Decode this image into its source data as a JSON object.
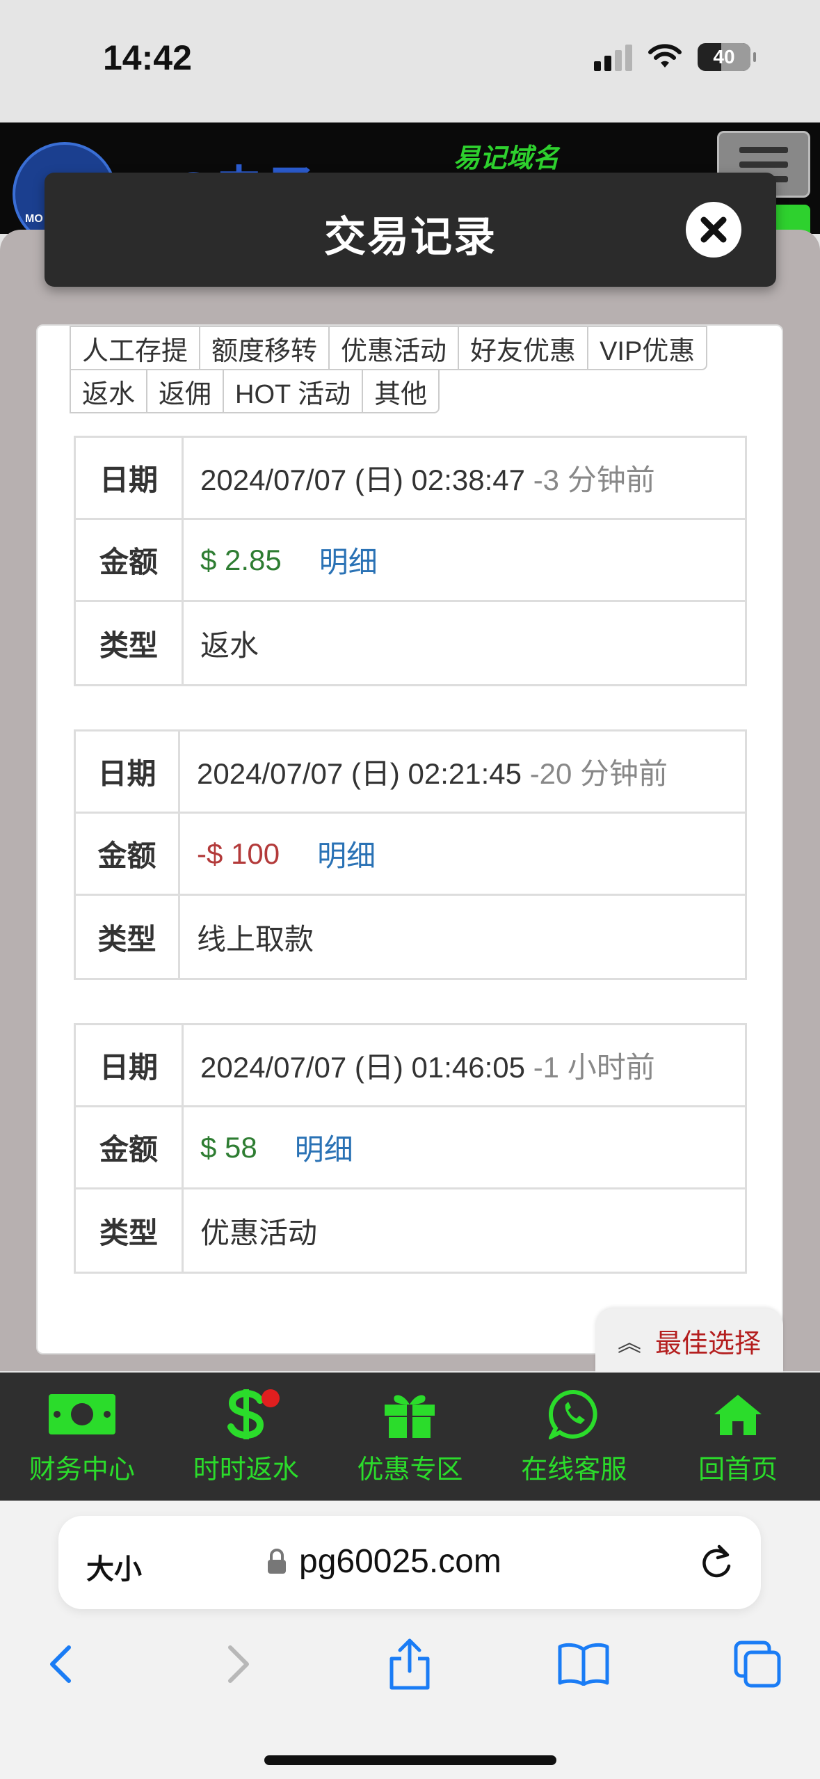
{
  "status_bar": {
    "time": "14:42",
    "battery": "40"
  },
  "site": {
    "logo_text": "PG电子",
    "logo_badge": "MO",
    "tagline": "易记域名"
  },
  "modal": {
    "title": "交易记录"
  },
  "tabs": {
    "row1": [
      "人工存提",
      "额度移转",
      "优惠活动",
      "好友优惠",
      "VIP优惠"
    ],
    "row2": [
      "返水",
      "返佣",
      "HOT 活动",
      "其他"
    ]
  },
  "labels": {
    "date": "日期",
    "amount": "金额",
    "type": "类型",
    "detail": "明细"
  },
  "records": [
    {
      "date": "2024/07/07 (日) 02:38:47",
      "ago": "-3 分钟前",
      "amount": "$ 2.85",
      "type": "返水"
    },
    {
      "date": "2024/07/07 (日) 02:21:45",
      "ago": "-20 分钟前",
      "amount": "-$ 100",
      "type": "线上取款"
    },
    {
      "date": "2024/07/07 (日) 01:46:05",
      "ago": "-1 小时前",
      "amount": "$ 58",
      "type": "优惠活动"
    }
  ],
  "best_choice": "最佳选择",
  "bottom_nav": [
    {
      "label": "财务中心",
      "icon": "money-icon"
    },
    {
      "label": "时时返水",
      "icon": "dollar-icon"
    },
    {
      "label": "优惠专区",
      "icon": "gift-icon"
    },
    {
      "label": "在线客服",
      "icon": "whatsapp-icon"
    },
    {
      "label": "回首页",
      "icon": "home-icon"
    }
  ],
  "browser": {
    "text_size": "大小",
    "url": "pg60025.com"
  },
  "colors": {
    "accent_green": "#2bdc2b",
    "positive": "#2e7d32",
    "negative": "#b33a3a",
    "link": "#2a72b5"
  }
}
